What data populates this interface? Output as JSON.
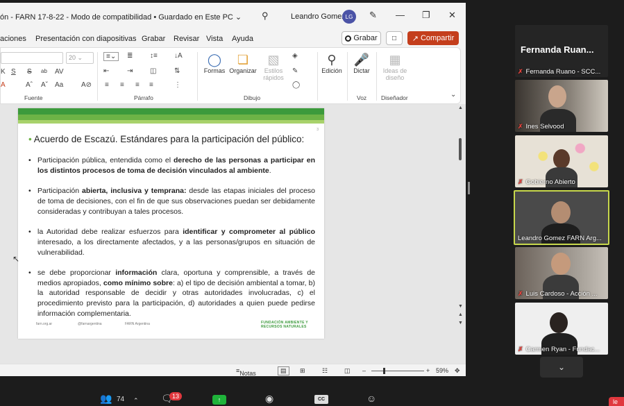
{
  "ppt": {
    "title": "ón - FARN 17-8-22  -  Modo de compatibilidad • Guardado en Este PC ⌄",
    "search_icon": "search-icon",
    "user_name": "Leandro Gomez",
    "user_initials": "LG",
    "tabs": [
      "aciones",
      "Presentación con diapositivas",
      "Grabar",
      "Revisar",
      "Vista",
      "Ayuda"
    ],
    "grabar_button": "Grabar",
    "share_button": "Compartir",
    "ribbon": {
      "font_size": "20",
      "groups": [
        "Fuente",
        "Párrafo",
        "Dibujo",
        "Voz",
        "Diseñador"
      ],
      "formas": "Formas",
      "organizar": "Organizar",
      "estilos": "Estilos rápidos",
      "edicion": "Edición",
      "dictar": "Dictar",
      "ideas": "Ideas de diseño"
    },
    "slide": {
      "number": "3",
      "title": "Acuerdo de Escazú. Estándares para la participación del público:",
      "b1_pre": "Participación pública, entendida como el ",
      "b1_bold": "derecho de las personas a participar en los distintos procesos de toma de decisión vinculados al ambiente",
      "b1_post": ".",
      "b2_pre": "Participación ",
      "b2_bold": "abierta, inclusiva y temprana:",
      "b2_post": " desde las etapas iniciales del proceso de toma de decisiones, con el fin de que sus observaciones puedan ser debidamente consideradas y contribuyan a tales procesos.",
      "b3_pre": "la Autoridad debe realizar esfuerzos para ",
      "b3_bold": "identificar y comprometer al público",
      "b3_post": " interesado, a los directamente afectados, y a las personas/grupos en situación de vulnerabilidad.",
      "b4_pre": "se debe proporcionar ",
      "b4_bold": "información",
      "b4_mid": " clara, oportuna y comprensible, a través de medios apropiados, ",
      "b4_bold2": "como mínimo sobre",
      "b4_post": ": a) el tipo de decisión ambiental a tomar, b) la autoridad responsable de decidir y otras autoridades involucradas, c) el procedimiento previsto para la participación, d) autoridades a quien puede pedirse información complementaria.",
      "footer_web": "farn.org.ar",
      "footer_social": "@farnargentina",
      "footer_name": "FARN Argentina",
      "footer_org_1": "FUNDACIÓN AMBIENTE Y",
      "footer_org_2": "RECURSOS NATURALES"
    },
    "status": {
      "notes": "Notas",
      "zoom": "59%"
    }
  },
  "zoom": {
    "participants": [
      {
        "name": "Fernanda Ruano - SCC...",
        "big_name": "Fernanda  Ruan...",
        "video": false
      },
      {
        "name": "Ines Selvood",
        "video": true
      },
      {
        "name": "Gobierno Abierto",
        "video": true
      },
      {
        "name": "Leandro Gomez FARN Arg...",
        "video": true,
        "active": true
      },
      {
        "name": "Luis Cardoso - Acción ...",
        "video": true
      },
      {
        "name": "Carmen Ryan - Fundac...",
        "video": true
      }
    ],
    "participant_count": "74",
    "chat_badge": "13",
    "cc_label": "CC",
    "leave_label": "le"
  }
}
